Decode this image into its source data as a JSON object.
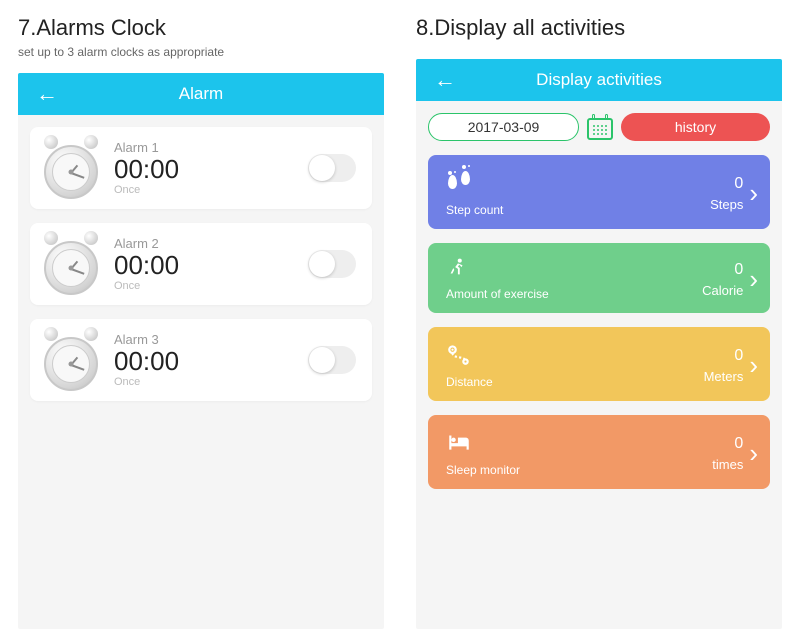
{
  "left": {
    "title": "7.Alarms Clock",
    "subtitle": "set up to 3 alarm clocks as appropriate",
    "header": "Alarm",
    "alarms": [
      {
        "label": "Alarm 1",
        "time": "00:00",
        "freq": "Once"
      },
      {
        "label": "Alarm 2",
        "time": "00:00",
        "freq": "Once"
      },
      {
        "label": "Alarm 3",
        "time": "00:00",
        "freq": "Once"
      }
    ]
  },
  "right": {
    "title": "8.Display all activities",
    "subtitle_spacer": " ",
    "header": "Display activities",
    "date": "2017-03-09",
    "history_label": "history",
    "cards": [
      {
        "label": "Step count",
        "value": "0",
        "unit": "Steps"
      },
      {
        "label": "Amount of exercise",
        "value": "0",
        "unit": "Calorie"
      },
      {
        "label": "Distance",
        "value": "0",
        "unit": "Meters"
      },
      {
        "label": "Sleep monitor",
        "value": "0",
        "unit": "times"
      }
    ]
  }
}
